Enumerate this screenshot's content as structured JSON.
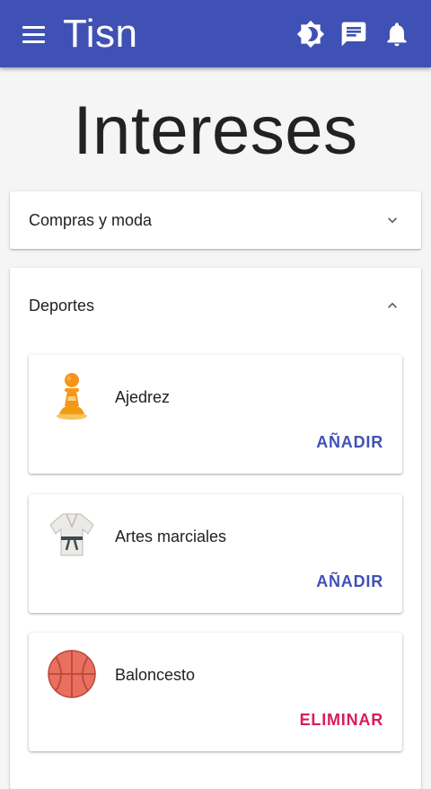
{
  "app_bar": {
    "title": "Tisn",
    "icons": [
      "menu-icon",
      "brightness-icon",
      "chat-icon",
      "notifications-icon"
    ],
    "color": "#3f51b5"
  },
  "page": {
    "title": "Intereses"
  },
  "panels": [
    {
      "label": "Compras y moda",
      "expanded": false
    },
    {
      "label": "Deportes",
      "expanded": true,
      "items": [
        {
          "name": "Ajedrez",
          "icon": "chess-pawn-icon",
          "action": "AÑADIR"
        },
        {
          "name": "Artes marciales",
          "icon": "martial-arts-gi-icon",
          "action": "AÑADIR"
        },
        {
          "name": "Baloncesto",
          "icon": "basketball-icon",
          "action": "ELIMINAR"
        }
      ]
    }
  ],
  "colors": {
    "primary": "#3f51b5",
    "add_action": "#3f51b5",
    "remove_action": "#d81b60",
    "background": "#f5f5f5"
  }
}
